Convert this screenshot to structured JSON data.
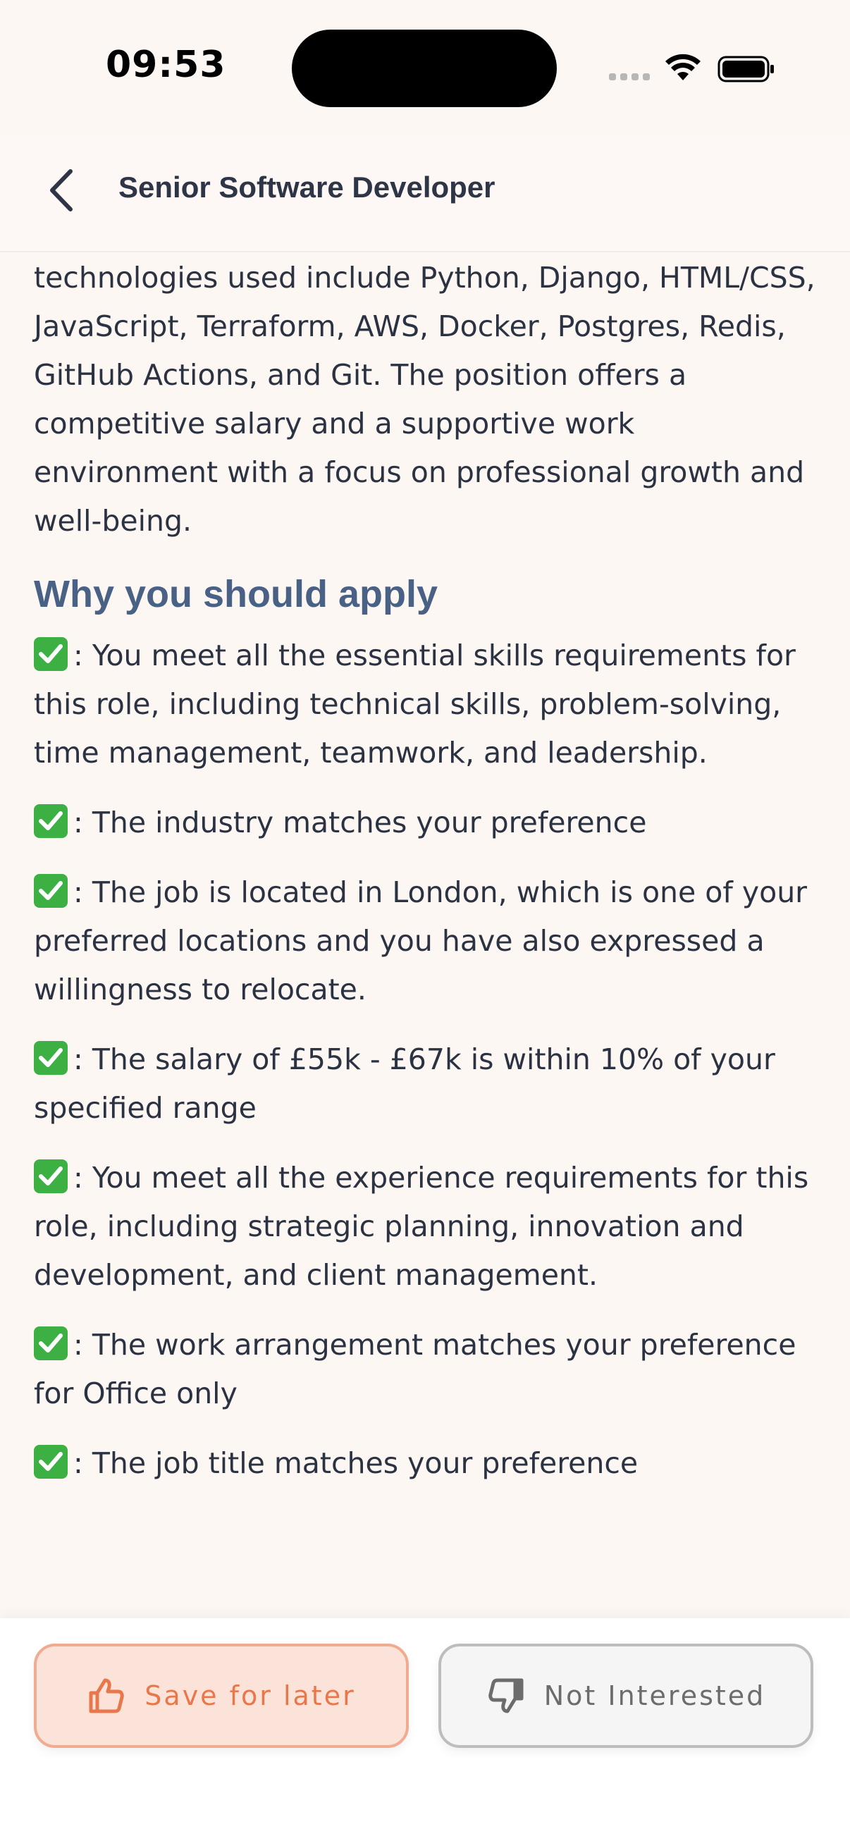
{
  "status_bar": {
    "time": "09:53"
  },
  "header": {
    "title": "Senior Software Developer"
  },
  "description": {
    "text": "technologies used include Python, Django, HTML/CSS, JavaScript, Terraform, AWS, Docker, Postgres, Redis, GitHub Actions, and Git. The position offers a competitive salary and a supportive work environment with a focus on professional growth and well-being."
  },
  "why_apply": {
    "heading": "Why you should apply",
    "reasons": [
      {
        "icon": "check-mark-icon",
        "text": ": You meet all the essential skills requirements for this role, including technical skills, problem-solving, time management, teamwork, and leadership."
      },
      {
        "icon": "check-mark-icon",
        "text": ": The industry matches your preference"
      },
      {
        "icon": "check-mark-icon",
        "text": ": The job is located in London, which is one of your preferred locations and you have also expressed a willingness to relocate."
      },
      {
        "icon": "check-mark-icon",
        "text": ": The salary of £55k - £67k is within 10% of your specified range"
      },
      {
        "icon": "check-mark-icon",
        "text": ": You meet all the experience requirements for this role, including strategic planning, innovation and development, and client management."
      },
      {
        "icon": "check-mark-icon",
        "text": ": The work arrangement matches your preference for Office only"
      },
      {
        "icon": "check-mark-icon",
        "text": ": The job title matches your preference"
      }
    ]
  },
  "actions": {
    "save_label": "Save for later",
    "not_interested_label": "Not Interested"
  },
  "colors": {
    "background": "#fdf7f4",
    "heading": "#4a6186",
    "accent": "#e8784b",
    "check": "#3cb043"
  }
}
